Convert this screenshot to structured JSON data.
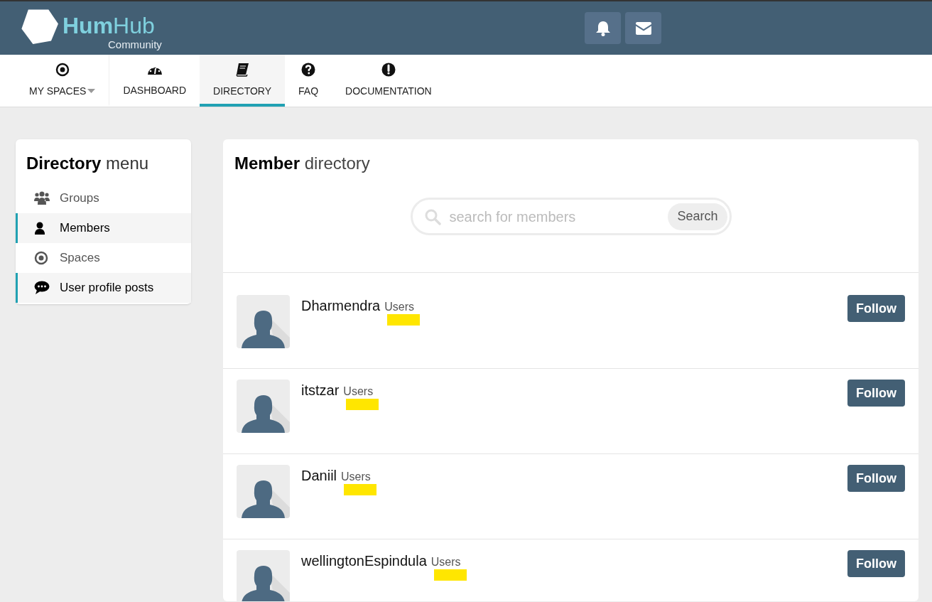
{
  "logo": {
    "name_bold": "Hum",
    "name_light": "Hub",
    "subtitle": "Community"
  },
  "header_buttons": [
    {
      "kind": "bell"
    },
    {
      "kind": "envelope"
    }
  ],
  "nav": [
    {
      "kind": "target",
      "label": "MY SPACES",
      "dropdown": true,
      "selected": false
    },
    {
      "kind": "dashboard",
      "label": "DASHBOARD",
      "dropdown": false,
      "selected": false
    },
    {
      "kind": "book",
      "label": "DIRECTORY",
      "dropdown": false,
      "selected": true
    },
    {
      "kind": "question",
      "label": "FAQ",
      "dropdown": false,
      "selected": false
    },
    {
      "kind": "exclamation",
      "label": "DOCUMENTATION",
      "dropdown": false,
      "selected": false
    }
  ],
  "sidebar": {
    "title_bold": "Directory",
    "title_light": "menu",
    "items": [
      {
        "kind": "users",
        "label": "Groups",
        "selected": false
      },
      {
        "kind": "user",
        "label": "Members",
        "selected": true
      },
      {
        "kind": "target",
        "label": "Spaces",
        "selected": false
      },
      {
        "kind": "comment",
        "label": "User profile posts",
        "selected": true
      }
    ]
  },
  "directory": {
    "title_bold": "Member",
    "title_light": "directory",
    "search": {
      "placeholder": "search for members",
      "button": "Search"
    },
    "members": [
      {
        "name": "Dharmendra",
        "group": "Users",
        "button": "Follow",
        "highlighted": true
      },
      {
        "name": "itstzar",
        "group": "Users",
        "button": "Follow",
        "highlighted": true
      },
      {
        "name": "Daniil",
        "group": "Users",
        "button": "Follow",
        "highlighted": true
      },
      {
        "name": "wellingtonEspindula",
        "group": "Users",
        "button": "Follow",
        "highlighted": true
      }
    ]
  }
}
